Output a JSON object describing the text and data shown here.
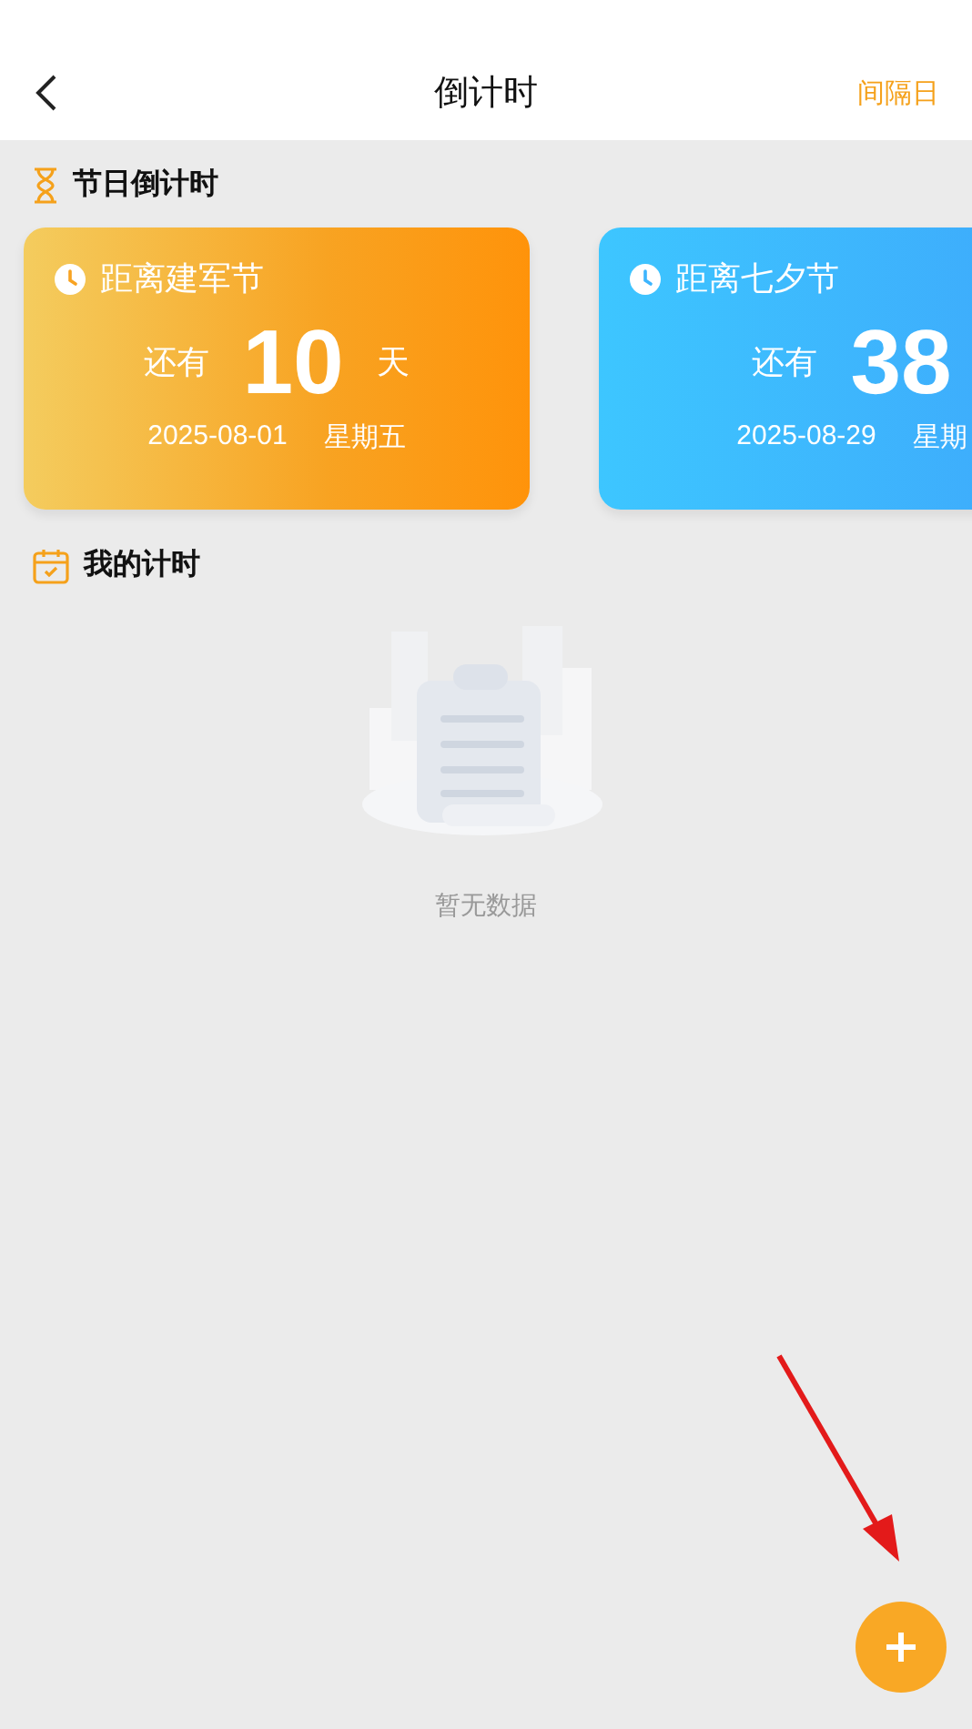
{
  "header": {
    "title": "倒计时",
    "action": "间隔日"
  },
  "holiday_section": {
    "title": "节日倒计时"
  },
  "cards": [
    {
      "kind": "warm",
      "title": "距离建军节",
      "prefix": "还有",
      "days": "10",
      "unit": "天",
      "date": "2025-08-01",
      "weekday": "星期五"
    },
    {
      "kind": "cool",
      "title": "距离七夕节",
      "prefix": "还有",
      "days": "38",
      "date": "2025-08-29",
      "weekday": "星期"
    }
  ],
  "my_section": {
    "title": "我的计时"
  },
  "empty_state": {
    "text": "暂无数据"
  },
  "fab": {
    "kind": "add"
  }
}
